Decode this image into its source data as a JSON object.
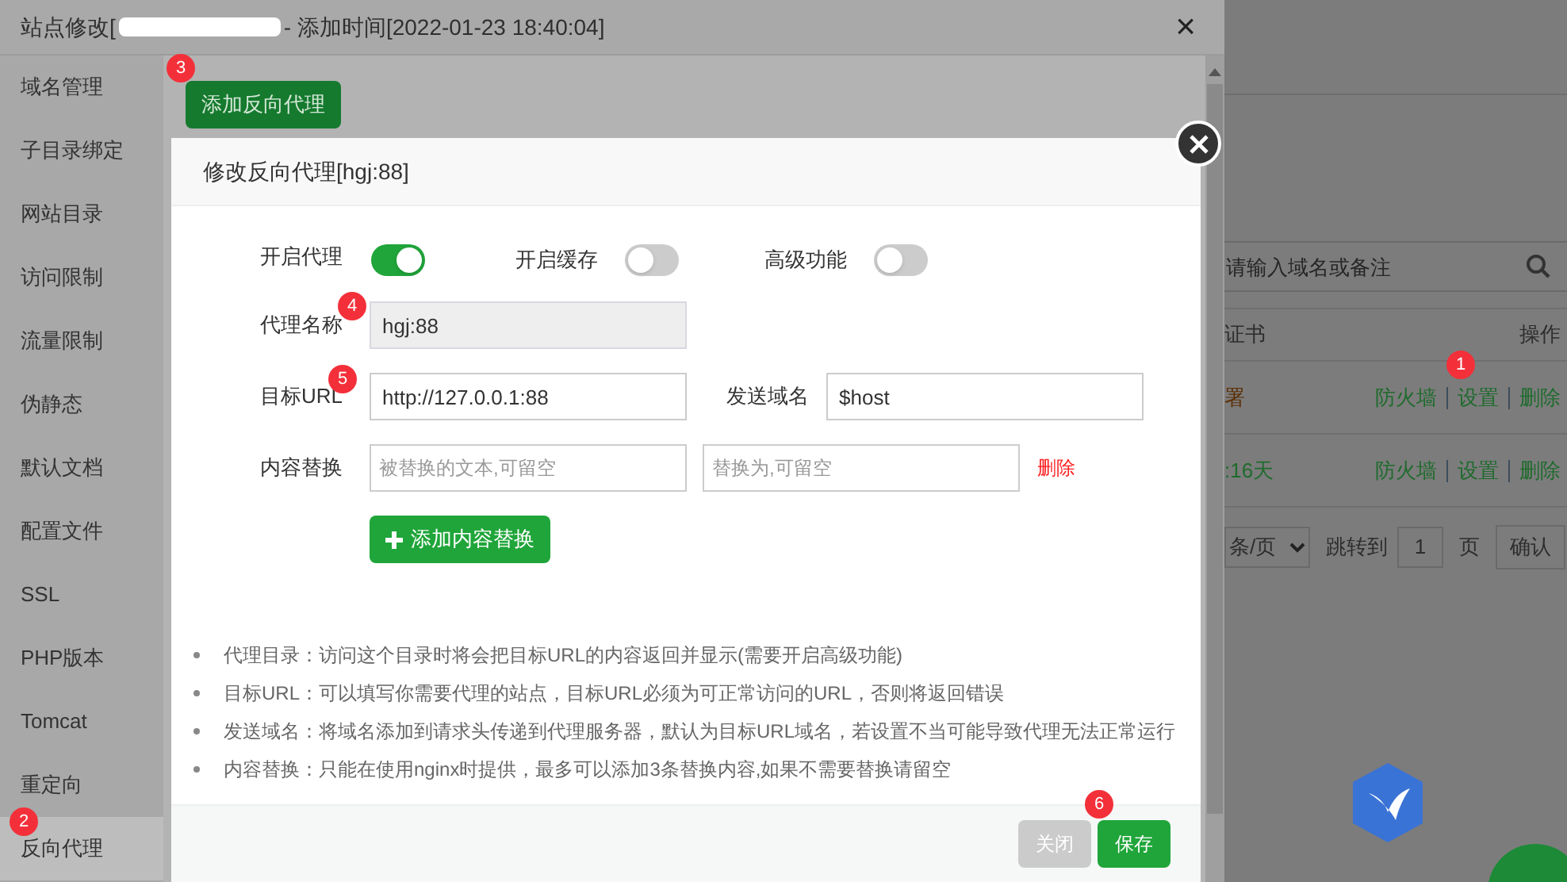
{
  "window": {
    "title_prefix": "站点修改[",
    "title_suffix": "- 添加时间[2022-01-23 18:40:04]",
    "close": "×"
  },
  "sidebar": {
    "items": [
      {
        "label": "域名管理",
        "selected": false
      },
      {
        "label": "子目录绑定",
        "selected": false
      },
      {
        "label": "网站目录",
        "selected": false
      },
      {
        "label": "访问限制",
        "selected": false
      },
      {
        "label": "流量限制",
        "selected": false
      },
      {
        "label": "伪静态",
        "selected": false
      },
      {
        "label": "默认文档",
        "selected": false
      },
      {
        "label": "配置文件",
        "selected": false
      },
      {
        "label": "SSL",
        "selected": false
      },
      {
        "label": "PHP版本",
        "selected": false
      },
      {
        "label": "Tomcat",
        "selected": false
      },
      {
        "label": "重定向",
        "selected": false
      },
      {
        "label": "反向代理",
        "selected": true
      }
    ]
  },
  "add_proxy_button": "添加反向代理",
  "background_page": {
    "search": {
      "placeholder": "请输入域名或备注"
    },
    "table": {
      "columns": [
        "证书",
        "操作"
      ],
      "rows": [
        {
          "status": "署",
          "color": "#5c2f06",
          "actions": [
            "防火墙",
            "设置",
            "删除"
          ]
        },
        {
          "status": ":16天",
          "color": "#1f6b2d",
          "actions": [
            "防火墙",
            "设置",
            "删除"
          ]
        }
      ]
    },
    "pagination": {
      "page_size": "条/页",
      "jump_label": "跳转到",
      "page": "1",
      "page_unit": "页",
      "confirm": "确认"
    }
  },
  "modal": {
    "title": "修改反向代理[hgj:88]",
    "toggles": [
      {
        "label": "开启代理",
        "on": true
      },
      {
        "label": "开启缓存",
        "on": false
      },
      {
        "label": "高级功能",
        "on": false
      }
    ],
    "proxy_name": {
      "label": "代理名称",
      "value": "hgj:88"
    },
    "target_url": {
      "label": "目标URL",
      "value": "http://127.0.0.1:88"
    },
    "send_domain": {
      "label": "发送域名",
      "value": "$host"
    },
    "content_replace": {
      "label": "内容替换",
      "from_placeholder": "被替换的文本,可留空",
      "to_placeholder": "替换为,可留空",
      "delete": "删除"
    },
    "add_replace_button": "添加内容替换",
    "notes": [
      "代理目录：访问这个目录时将会把目标URL的内容返回并显示(需要开启高级功能)",
      "目标URL：可以填写你需要代理的站点，目标URL必须为可正常访问的URL，否则将返回错误",
      "发送域名：将域名添加到请求头传递到代理服务器，默认为目标URL域名，若设置不当可能导致代理无法正常运行",
      "内容替换：只能在使用nginx时提供，最多可以添加3条替换内容,如果不需要替换请留空"
    ],
    "buttons": {
      "close": "关闭",
      "save": "保存"
    }
  },
  "badges": [
    "1",
    "2",
    "3",
    "4",
    "5",
    "6"
  ]
}
